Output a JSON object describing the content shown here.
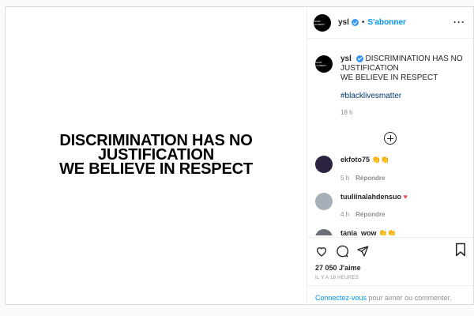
{
  "media": {
    "line1": "DISCRIMINATION HAS NO",
    "line2": "JUSTIFICATION",
    "line3": "WE BELIEVE IN RESPECT"
  },
  "header": {
    "username": "ysl",
    "separator": "•",
    "follow_label": "S'abonner",
    "more_label": "···"
  },
  "caption": {
    "username": "ysl",
    "text_line1": "DISCRIMINATION HAS NO",
    "text_line2": "JUSTIFICATION",
    "text_line3": "WE BELIEVE IN RESPECT",
    "hashtag": "#blacklivesmatter",
    "time": "18 h"
  },
  "comments": [
    {
      "username": "ekfoto75",
      "text": "👏👏",
      "time": "5 h",
      "reply": "Répondre",
      "avatar_color": "#2b2340"
    },
    {
      "username": "tuuliinalahdensuo",
      "text": "♥",
      "time": "4 h",
      "reply": "Répondre",
      "avatar_color": "#a7b0b8"
    },
    {
      "username": "tania_wow",
      "text": "👏👏",
      "time": "",
      "reply": "",
      "avatar_color": "#6b6f77"
    }
  ],
  "actions": {
    "likes": "27 050 J'aime",
    "posted": "IL Y A 18 HEURES"
  },
  "login": {
    "link": "Connectez-vous",
    "text": " pour aimer ou commenter."
  },
  "colors": {
    "accent": "#0095f6",
    "verified": "#3897f0",
    "heart": "#ed4956"
  }
}
